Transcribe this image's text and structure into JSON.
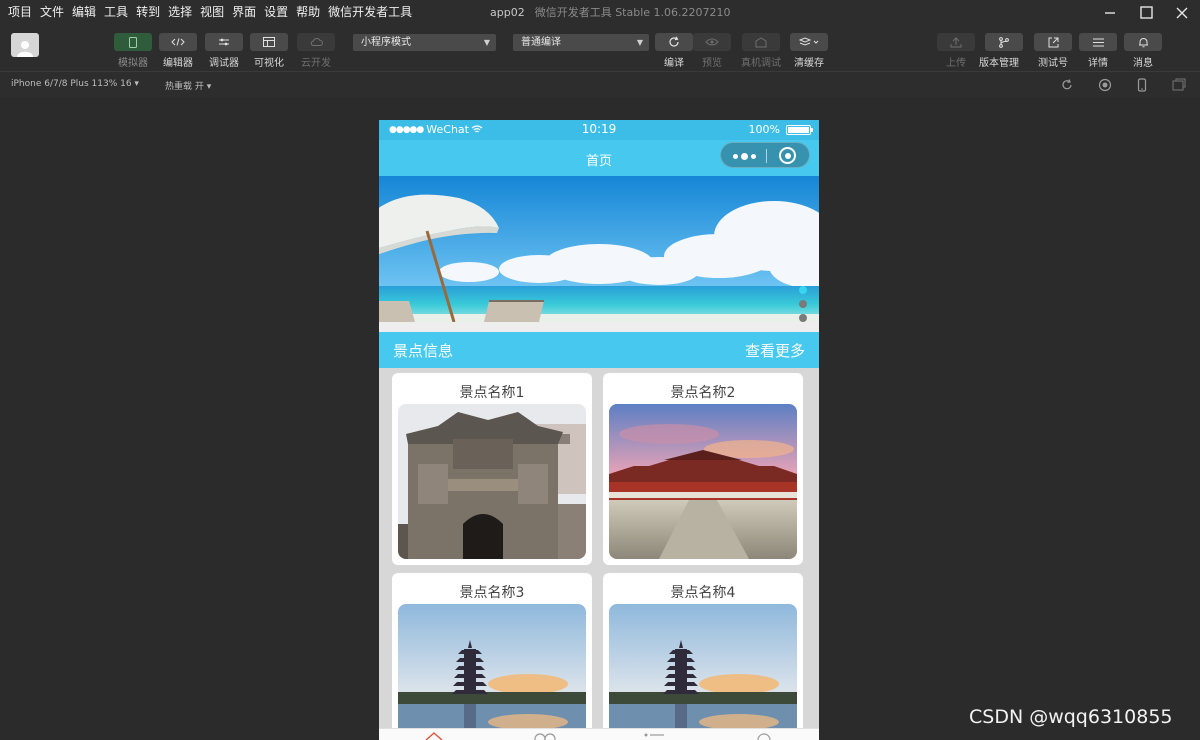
{
  "menu": [
    "项目",
    "文件",
    "编辑",
    "工具",
    "转到",
    "选择",
    "视图",
    "界面",
    "设置",
    "帮助",
    "微信开发者工具"
  ],
  "window": {
    "app_name": "app02",
    "title": "微信开发者工具 Stable 1.06.2207210"
  },
  "toolbar": {
    "simulator": "模拟器",
    "editor": "编辑器",
    "debugger": "调试器",
    "visual": "可视化",
    "cloud": "云开发",
    "mode_select": "小程序模式",
    "compile_select": "普通编译",
    "compile": "编译",
    "preview": "预览",
    "remote_debug": "真机调试",
    "clear_cache": "清缓存",
    "upload": "上传",
    "version": "版本管理",
    "test_id": "测试号",
    "details": "详情",
    "messages": "消息"
  },
  "subbar": {
    "device": "iPhone 6/7/8 Plus 113% 16 ▾",
    "hotload": "热重载 开 ▾"
  },
  "phone": {
    "status": {
      "carrier": "WeChat",
      "time": "10:19",
      "battery": "100%"
    },
    "nav_title": "首页",
    "swiper": {
      "count": 3,
      "active": 0
    },
    "section": {
      "title": "景点信息",
      "more": "查看更多"
    },
    "cards": [
      {
        "name": "景点名称1"
      },
      {
        "name": "景点名称2"
      },
      {
        "name": "景点名称3"
      },
      {
        "name": "景点名称4"
      }
    ]
  },
  "watermark": "CSDN @wqq6310855",
  "colors": {
    "accent": "#47c9ef",
    "status": "#3cbde8",
    "chrome": "#2d2d2d",
    "active_tool": "#2f5d3c"
  }
}
